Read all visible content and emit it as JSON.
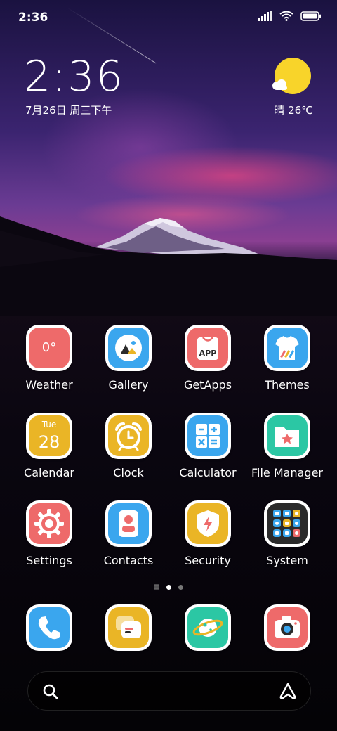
{
  "status_bar": {
    "time": "2:36"
  },
  "clock_widget": {
    "time": "2:36",
    "date": "7月26日 周三下午"
  },
  "weather_widget": {
    "text": "晴 26℃"
  },
  "apps": [
    {
      "label": "Weather",
      "icon": "weather-icon",
      "value": "0°"
    },
    {
      "label": "Gallery",
      "icon": "gallery-icon"
    },
    {
      "label": "GetApps",
      "icon": "getapps-icon",
      "badge": "APP"
    },
    {
      "label": "Themes",
      "icon": "themes-icon"
    },
    {
      "label": "Calendar",
      "icon": "calendar-icon",
      "day": "Tue",
      "date": "28"
    },
    {
      "label": "Clock",
      "icon": "alarm-clock-icon"
    },
    {
      "label": "Calculator",
      "icon": "calculator-icon"
    },
    {
      "label": "File Manager",
      "icon": "folder-icon"
    },
    {
      "label": "Settings",
      "icon": "gear-icon"
    },
    {
      "label": "Contacts",
      "icon": "contacts-icon"
    },
    {
      "label": "Security",
      "icon": "shield-icon"
    },
    {
      "label": "System",
      "icon": "folder-grid-icon"
    }
  ],
  "dock": [
    {
      "icon": "phone-icon"
    },
    {
      "icon": "messages-icon"
    },
    {
      "icon": "browser-planet-icon"
    },
    {
      "icon": "camera-icon"
    }
  ],
  "page_indicator": {
    "pages": 3,
    "current": 2
  },
  "colors": {
    "red": "#ee6a6a",
    "blue": "#3aa6ee",
    "yellow": "#eab526",
    "green": "#2bc7a4",
    "dark": "#2b2b2b"
  }
}
